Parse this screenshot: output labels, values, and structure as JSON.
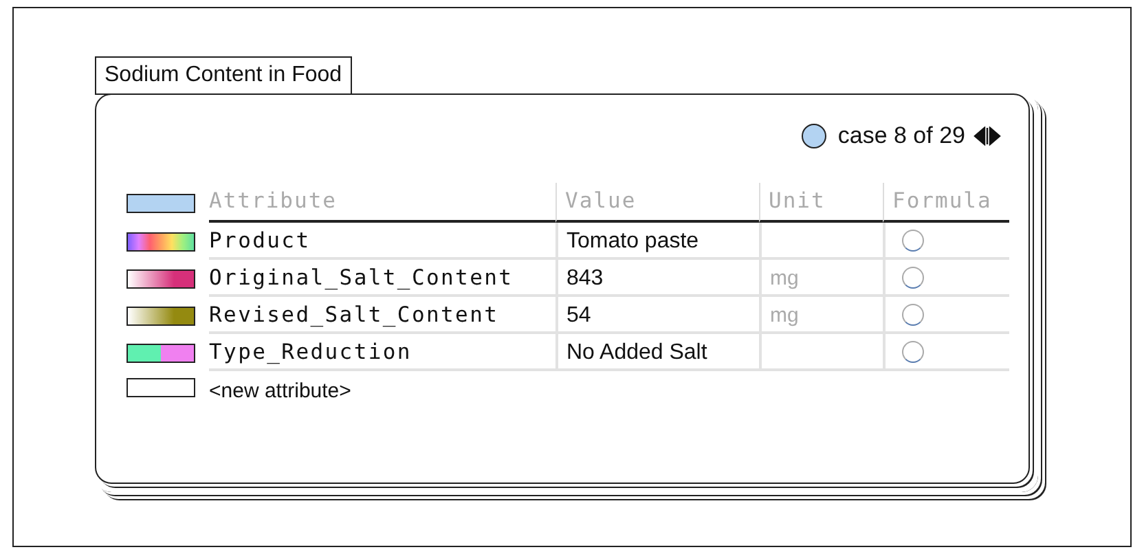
{
  "title": "Sodium Content in Food",
  "case_nav": {
    "text": "case 8 of 29"
  },
  "table": {
    "columns": [
      "Attribute",
      "Value",
      "Unit",
      "Formula"
    ],
    "rows": [
      {
        "attribute": "Product",
        "value": "Tomato paste",
        "kind": "rainbow"
      },
      {
        "attribute": "Original_Salt_Content",
        "value": "843",
        "unit": "mg",
        "kind": "scale",
        "color": "#d6307a"
      },
      {
        "attribute": "Revised_Salt_Content",
        "value": "54",
        "unit": "mg",
        "kind": "scale",
        "color": "#948a10"
      },
      {
        "attribute": "Type_Reduction",
        "value": "No Added Salt",
        "kind": "split"
      }
    ],
    "new_row": "<new attribute>"
  }
}
